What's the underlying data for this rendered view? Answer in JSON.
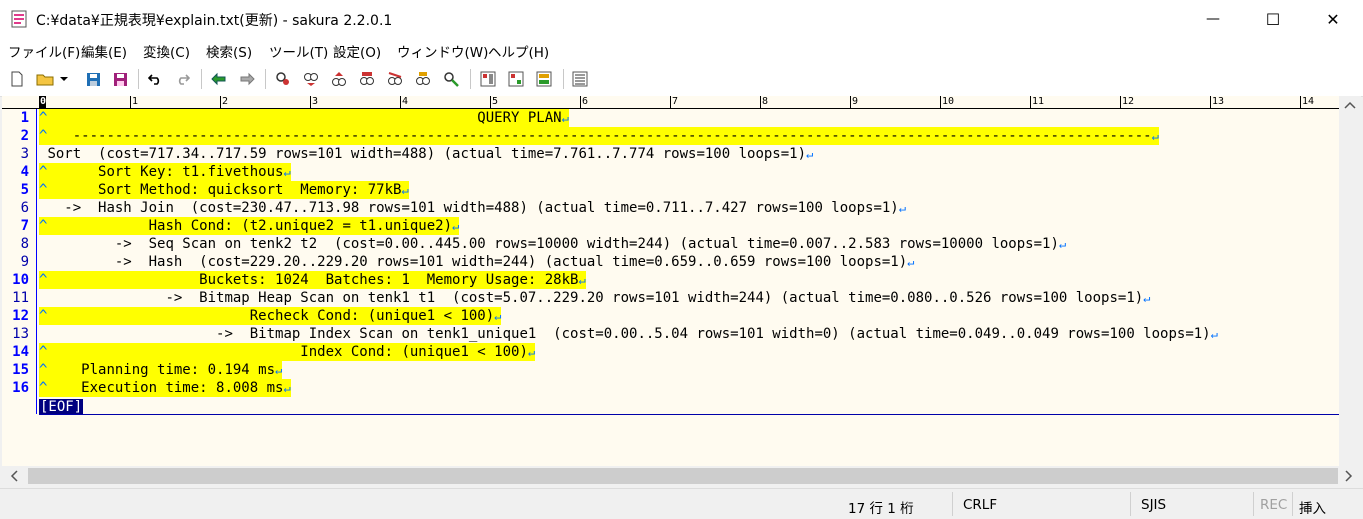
{
  "window": {
    "title": "C:¥data¥正規表現¥explain.txt(更新) - sakura 2.2.0.1",
    "minimize_glyph": "—",
    "maximize_glyph": "☐",
    "close_glyph": "✕"
  },
  "menu": [
    {
      "label": "ファイル(F)"
    },
    {
      "label": "編集(E)"
    },
    {
      "label": "変換(C)"
    },
    {
      "label": "検索(S)"
    },
    {
      "label": "ツール(T)"
    },
    {
      "label": "設定(O)"
    },
    {
      "label": "ウィンドウ(W)"
    },
    {
      "label": "ヘルプ(H)"
    }
  ],
  "toolbar_icons": [
    "new-file-icon",
    "open-folder-icon",
    "dropdown-arrow-icon",
    "save-icon",
    "save-all-icon",
    "undo-icon",
    "redo-icon",
    "jump-back-icon",
    "jump-forward-icon",
    "search-icon",
    "search-next-icon",
    "search-prev-icon",
    "search-dialog-icon",
    "replace-icon",
    "grep-icon",
    "clear-mark-icon",
    "outline-icon",
    "compare-icon",
    "tag-jump-icon",
    "settings-icon"
  ],
  "ruler": [
    "0",
    "1",
    "2",
    "3",
    "4",
    "5",
    "6",
    "7",
    "8",
    "9",
    "10",
    "11",
    "12",
    "13",
    "14"
  ],
  "editor": {
    "lines": [
      {
        "no": "1",
        "text": "                                                   QUERY PLAN",
        "highlight": true,
        "caret": true
      },
      {
        "no": "2",
        "text": "   --------------------------------------------------------------------------------------------------------------------------------",
        "highlight": true,
        "caret": true
      },
      {
        "no": "3",
        "text": "Sort  (cost=717.34..717.59 rows=101 width=488) (actual time=7.761..7.774 rows=100 loops=1)",
        "highlight": false,
        "caret": false
      },
      {
        "no": "4",
        "text": "      Sort Key: t1.fivethous",
        "highlight": true,
        "caret": true
      },
      {
        "no": "5",
        "text": "      Sort Method: quicksort  Memory: 77kB",
        "highlight": true,
        "caret": true
      },
      {
        "no": "6",
        "text": "  ->  Hash Join  (cost=230.47..713.98 rows=101 width=488) (actual time=0.711..7.427 rows=100 loops=1)",
        "highlight": false,
        "caret": false
      },
      {
        "no": "7",
        "text": "            Hash Cond: (t2.unique2 = t1.unique2)",
        "highlight": true,
        "caret": true
      },
      {
        "no": "8",
        "text": "        ->  Seq Scan on tenk2 t2  (cost=0.00..445.00 rows=10000 width=244) (actual time=0.007..2.583 rows=10000 loops=1)",
        "highlight": false,
        "caret": false
      },
      {
        "no": "9",
        "text": "        ->  Hash  (cost=229.20..229.20 rows=101 width=244) (actual time=0.659..0.659 rows=100 loops=1)",
        "highlight": false,
        "caret": false
      },
      {
        "no": "10",
        "text": "                  Buckets: 1024  Batches: 1  Memory Usage: 28kB",
        "highlight": true,
        "caret": true
      },
      {
        "no": "11",
        "text": "              ->  Bitmap Heap Scan on tenk1 t1  (cost=5.07..229.20 rows=101 width=244) (actual time=0.080..0.526 rows=100 loops=1)",
        "highlight": false,
        "caret": false
      },
      {
        "no": "12",
        "text": "                        Recheck Cond: (unique1 < 100)",
        "highlight": true,
        "caret": true
      },
      {
        "no": "13",
        "text": "                    ->  Bitmap Index Scan on tenk1_unique1  (cost=0.00..5.04 rows=101 width=0) (actual time=0.049..0.049 rows=100 loops=1)",
        "highlight": false,
        "caret": false
      },
      {
        "no": "14",
        "text": "                              Index Cond: (unique1 < 100)",
        "highlight": true,
        "caret": true
      },
      {
        "no": "15",
        "text": "    Planning time: 0.194 ms",
        "highlight": true,
        "caret": true
      },
      {
        "no": "16",
        "text": "    Execution time: 8.008 ms",
        "highlight": true,
        "caret": true
      }
    ],
    "eof_marker": "[EOF]",
    "caret_glyph": "^",
    "return_glyph": "↵"
  },
  "status": {
    "position": "17 行   1 桁",
    "line_ending": "CRLF",
    "encoding": "SJIS",
    "rec": "REC",
    "mode": "挿入"
  },
  "colors": {
    "highlight": "#ffff00",
    "editor_bg": "#fffbf0",
    "line_number": "#0000aa",
    "eof_bg": "#000080"
  }
}
